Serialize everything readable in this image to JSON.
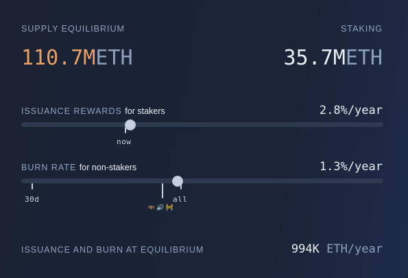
{
  "header": {
    "supply_label": "SUPPLY EQUILIBRIUM",
    "staking_label": "STAKING"
  },
  "supply": {
    "amount": "110.7M",
    "unit": "ETH"
  },
  "staking": {
    "amount": "35.7M",
    "unit": "ETH"
  },
  "issuance": {
    "label": "ISSUANCE REWARDS",
    "sublabel": "for stakers",
    "rate_value": "2.8%",
    "rate_unit": "/year",
    "slider_level": 0.3,
    "marker_label": "now"
  },
  "burn": {
    "label": "BURN RATE",
    "sublabel": "for non-stakers",
    "rate_value": "1.3%",
    "rate_unit": "/year",
    "slider_level": 0.43,
    "marker_left_label": "30d",
    "marker_right_label": "all",
    "emoji_icons": [
      "🦇",
      "🔊",
      "🚧"
    ]
  },
  "equilibrium": {
    "label": "ISSUANCE AND BURN AT EQUILIBRIUM",
    "value": "994K",
    "unit": "ETH/year"
  },
  "colors": {
    "accent_amber": "#e8a164",
    "muted_text": "#8ea2bd",
    "primary_text": "#e9eef6",
    "track": "#2d3a4f",
    "thumb": "#c5cfe0"
  }
}
